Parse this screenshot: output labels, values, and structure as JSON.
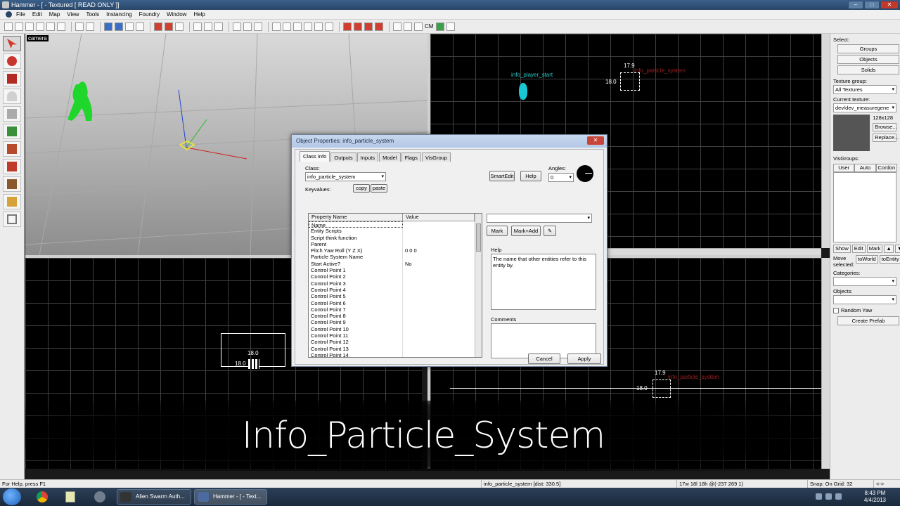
{
  "window": {
    "title": "Hammer - [ - Textured [ READ ONLY ]]",
    "controls": {
      "minimize": "–",
      "maximize": "□",
      "close": "✕"
    }
  },
  "menu": [
    "File",
    "Edit",
    "Map",
    "View",
    "Tools",
    "Instancing",
    "Foundry",
    "Window",
    "Help"
  ],
  "toolbar": {
    "cm_label": "CM"
  },
  "viewports": {
    "camera_label": "camera",
    "top_right": {
      "entity_player": "info_player_start",
      "entity_particle": "info_particle_system",
      "dim_x": "17.9",
      "dim_y": "18.0"
    },
    "bottom_left": {
      "dim_x": "18.0",
      "dim_y": "18.0"
    },
    "bottom_right": {
      "entity_particle": "info_particle_system",
      "dim_x": "17.9",
      "dim_y": "18.0"
    }
  },
  "dialog": {
    "title": "Object Properties: info_particle_system",
    "close": "✕",
    "tabs": [
      "Class Info",
      "Outputs",
      "Inputs",
      "Model",
      "Flags",
      "VisGroup"
    ],
    "class_label": "Class:",
    "class_value": "info_particle_system",
    "keyvalues_label": "Keyvalues:",
    "copy": "copy",
    "paste": "paste",
    "smartedit": "SmartEdit",
    "help_btn": "Help",
    "angles_label": "Angles:",
    "angles_value": "0",
    "columns": [
      "Property Name",
      "Value"
    ],
    "properties": [
      {
        "name": "Name",
        "value": ""
      },
      {
        "name": "Entity Scripts",
        "value": ""
      },
      {
        "name": "Script think function",
        "value": ""
      },
      {
        "name": "Parent",
        "value": ""
      },
      {
        "name": "Pitch Yaw Roll (Y Z X)",
        "value": "0 0 0"
      },
      {
        "name": "Particle System Name",
        "value": ""
      },
      {
        "name": "Start Active?",
        "value": "No"
      },
      {
        "name": "Control Point 1",
        "value": ""
      },
      {
        "name": "Control Point 2",
        "value": ""
      },
      {
        "name": "Control Point 3",
        "value": ""
      },
      {
        "name": "Control Point 4",
        "value": ""
      },
      {
        "name": "Control Point 5",
        "value": ""
      },
      {
        "name": "Control Point 6",
        "value": ""
      },
      {
        "name": "Control Point 7",
        "value": ""
      },
      {
        "name": "Control Point 8",
        "value": ""
      },
      {
        "name": "Control Point 9",
        "value": ""
      },
      {
        "name": "Control Point 10",
        "value": ""
      },
      {
        "name": "Control Point 11",
        "value": ""
      },
      {
        "name": "Control Point 12",
        "value": ""
      },
      {
        "name": "Control Point 13",
        "value": ""
      },
      {
        "name": "Control Point 14",
        "value": ""
      }
    ],
    "mark": "Mark",
    "mark_add": "Mark+Add",
    "help_label": "Help",
    "help_text": "The name that other entities refer to this entity by.",
    "comments_label": "Comments",
    "cancel": "Cancel",
    "apply": "Apply"
  },
  "right_panel": {
    "select_label": "Select:",
    "groups": "Groups",
    "objects": "Objects",
    "solids": "Solids",
    "texture_group_label": "Texture group:",
    "texture_group_value": "All Textures",
    "current_texture_label": "Current texture:",
    "current_texture_value": "dev/dev_measuregene",
    "texture_size": "128x128",
    "browse": "Browse...",
    "replace": "Replace...",
    "visgroups_label": "VisGroups:",
    "vis_tabs": [
      "User",
      "Auto",
      "Cordon"
    ],
    "show": "Show",
    "edit": "Edit",
    "mark": "Mark",
    "up": "▲",
    "down": "▼",
    "move_selected": "Move selected:",
    "to_world": "toWorld",
    "to_entity": "toEntity",
    "categories_label": "Categories:",
    "objects_label": "Objects:",
    "random_yaw": "Random Yaw",
    "create_prefab": "Create Prefab"
  },
  "caption": "Info_Particle_System",
  "status": {
    "help": "For Help, press F1",
    "selection": "info_particle_system   [dist: 330.5]",
    "size": "17w 18l 18h @(-237 269 1)",
    "snap": "Snap: On Grid: 32",
    "arrow": "<->"
  },
  "taskbar": {
    "tasks": [
      "Alien Swarm Auth...",
      "Hammer - [ - Text..."
    ],
    "time": "8:43 PM",
    "date": "4/4/2013"
  }
}
